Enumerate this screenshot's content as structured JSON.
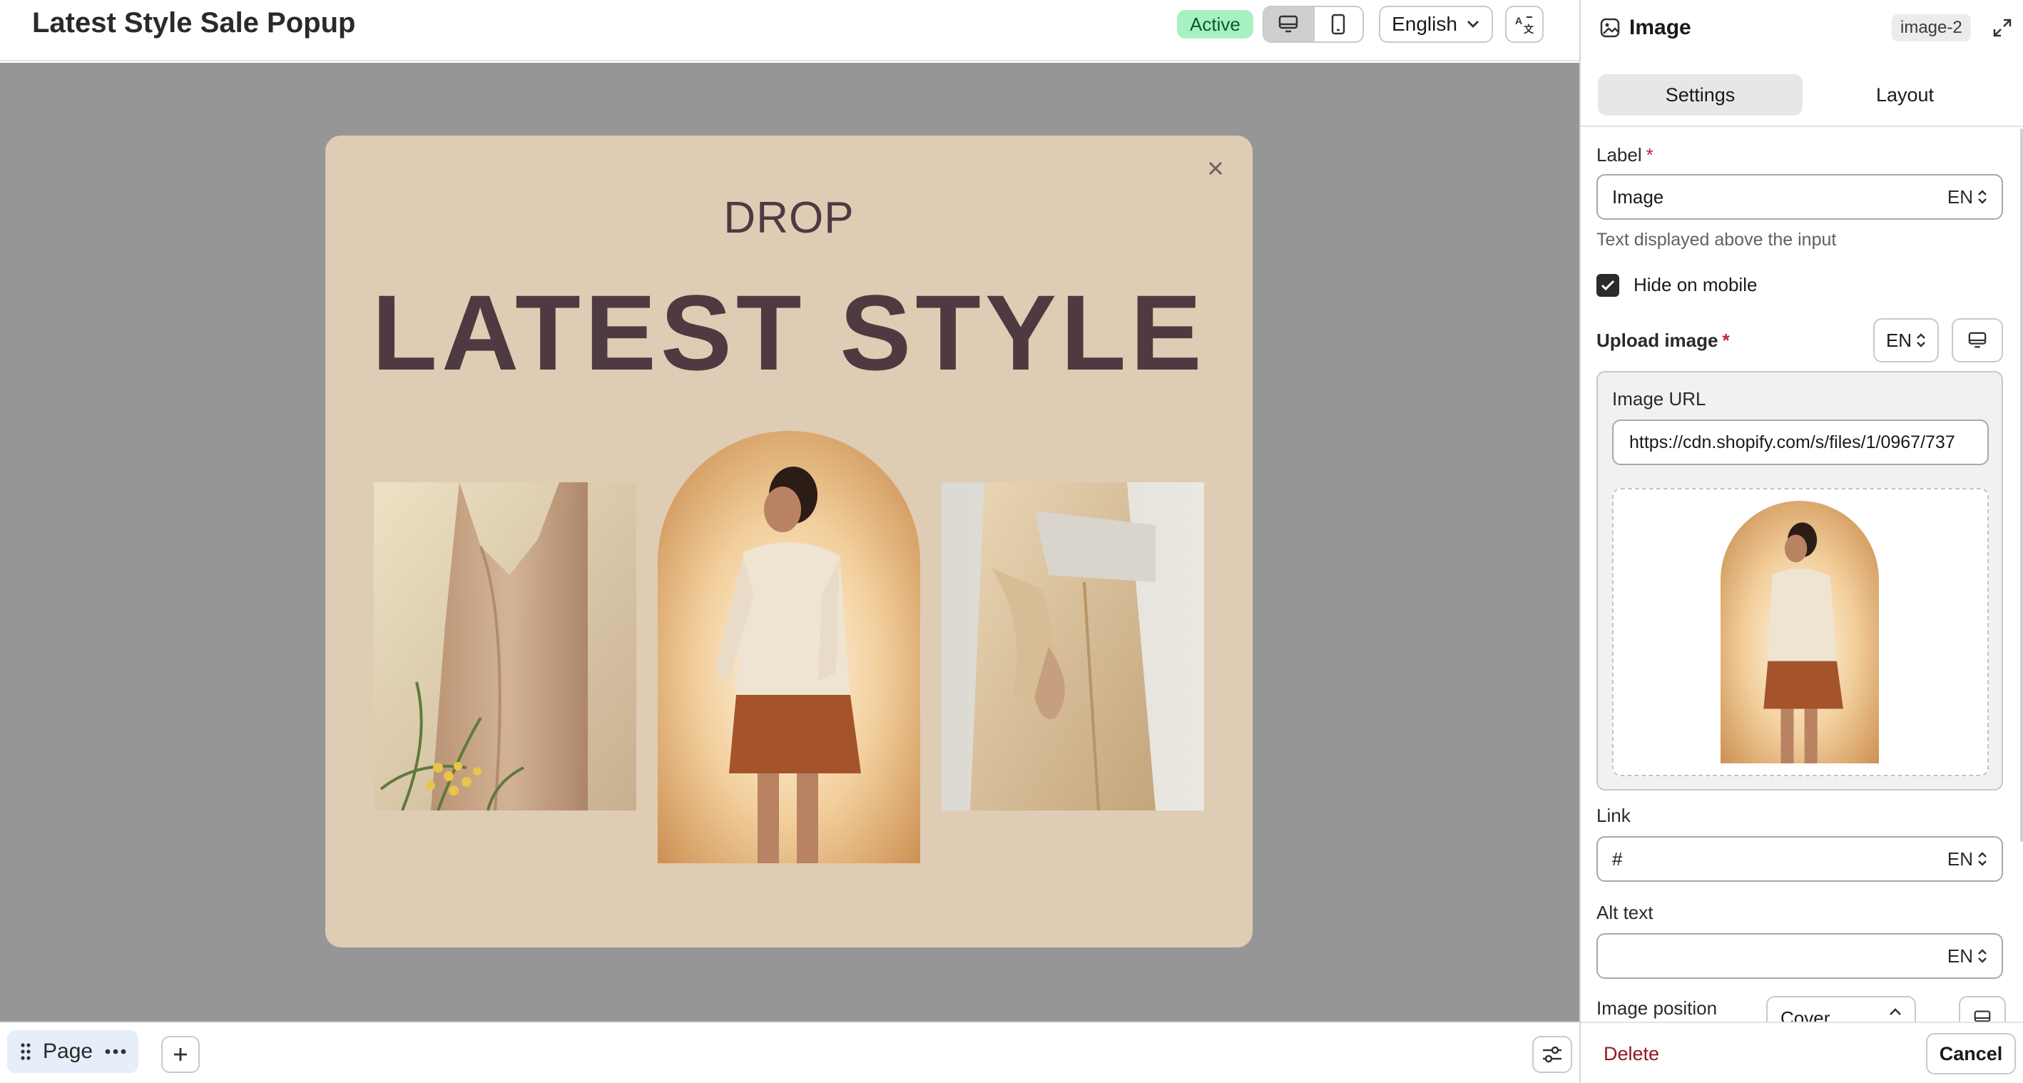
{
  "header": {
    "title": "Latest Style Sale Popup",
    "status": "Active",
    "language": "English"
  },
  "popup": {
    "subtitle": "DROP",
    "title": "LATEST STYLE"
  },
  "bottom": {
    "page_label": "Page"
  },
  "panel": {
    "title": "Image",
    "id": "image-2",
    "tabs": [
      "Settings",
      "Layout"
    ],
    "label_field": {
      "label": "Label",
      "required": "*",
      "value": "Image",
      "locale": "EN",
      "help": "Text displayed above the input"
    },
    "hide_mobile": {
      "label": "Hide on mobile",
      "checked": true
    },
    "upload": {
      "label": "Upload image",
      "required": "*",
      "locale": "EN",
      "url_label": "Image URL",
      "url_value": "https://cdn.shopify.com/s/files/1/0967/737"
    },
    "link": {
      "label": "Link",
      "value": "#",
      "locale": "EN"
    },
    "alt": {
      "label": "Alt text",
      "value": "",
      "locale": "EN"
    },
    "position": {
      "label": "Image position",
      "value": "Cover"
    },
    "footer": {
      "delete": "Delete",
      "cancel": "Cancel"
    }
  },
  "colors": {
    "popup_bg": "#dfccb4",
    "popup_text": "#4e3a40",
    "canvas_bg": "#969696",
    "active_badge": "#a8f0c0",
    "delete_text": "#8e1b20"
  }
}
